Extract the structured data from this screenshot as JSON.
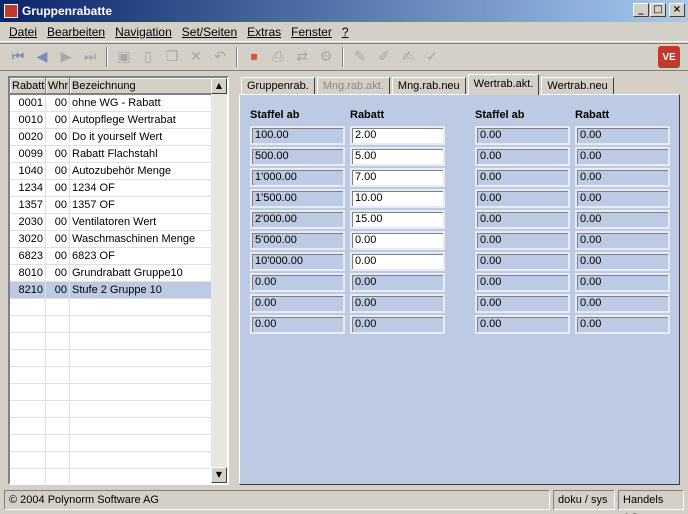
{
  "window": {
    "title": "Gruppenrabatte"
  },
  "menu": [
    "Datei",
    "Bearbeiten",
    "Navigation",
    "Set/Seiten",
    "Extras",
    "Fenster",
    "?"
  ],
  "list": {
    "headers": [
      "Rabatt",
      "Whr",
      "Bezeichnung"
    ],
    "rows": [
      [
        "0001",
        "00",
        "ohne WG - Rabatt"
      ],
      [
        "0010",
        "00",
        "Autopflege Wertrabat"
      ],
      [
        "0020",
        "00",
        "Do it yourself Wert"
      ],
      [
        "0099",
        "00",
        "Rabatt Flachstahl"
      ],
      [
        "1040",
        "00",
        "Autozubehör Menge"
      ],
      [
        "1234",
        "00",
        "1234 OF"
      ],
      [
        "1357",
        "00",
        "1357 OF"
      ],
      [
        "2030",
        "00",
        "Ventilatoren Wert"
      ],
      [
        "3020",
        "00",
        "Waschmaschinen Menge"
      ],
      [
        "6823",
        "00",
        "6823 OF"
      ],
      [
        "8010",
        "00",
        "Grundrabatt Gruppe10"
      ],
      [
        "8210",
        "00",
        "Stufe 2 Gruppe 10"
      ]
    ],
    "selected_index": 11
  },
  "tabs": [
    {
      "label": "Gruppenrab.",
      "state": "normal"
    },
    {
      "label": "Mng.rab.akt.",
      "state": "disabled"
    },
    {
      "label": "Mng.rab.neu",
      "state": "normal"
    },
    {
      "label": "Wertrab.akt.",
      "state": "active"
    },
    {
      "label": "Wertrab.neu",
      "state": "normal"
    }
  ],
  "grid": {
    "headers": [
      "Staffel ab",
      "Rabatt",
      "Staffel ab",
      "Rabatt"
    ],
    "left_staffel": [
      "100.00",
      "500.00",
      "1'000.00",
      "1'500.00",
      "2'000.00",
      "5'000.00",
      "10'000.00",
      "0.00",
      "0.00",
      "0.00"
    ],
    "left_rabatt": [
      "2.00",
      "5.00",
      "7.00",
      "10.00",
      "15.00",
      "0.00",
      "0.00",
      "0.00",
      "0.00",
      "0.00"
    ],
    "left_rabatt_editable_rows": 7,
    "right_staffel": [
      "0.00",
      "0.00",
      "0.00",
      "0.00",
      "0.00",
      "0.00",
      "0.00",
      "0.00",
      "0.00",
      "0.00"
    ],
    "right_rabatt": [
      "0.00",
      "0.00",
      "0.00",
      "0.00",
      "0.00",
      "0.00",
      "0.00",
      "0.00",
      "0.00",
      "0.00"
    ]
  },
  "status": {
    "copyright": "© 2004 Polynorm Software AG",
    "user": "doku / sys",
    "company": "Handels AG"
  },
  "colors": {
    "title_start": "#0a246a",
    "title_end": "#a6caf0",
    "panel": "#bccbe3",
    "brand": "#c0392b"
  },
  "toolbar_icons": [
    "first-record-icon",
    "prev-record-icon",
    "next-record-icon",
    "last-record-icon",
    "save-icon",
    "new-icon",
    "copy-icon",
    "delete-icon",
    "undo-icon",
    "stop-icon",
    "print-icon",
    "export-icon",
    "settings-icon",
    "edit-icon",
    "pen-icon",
    "doc-edit-icon",
    "check-icon"
  ]
}
